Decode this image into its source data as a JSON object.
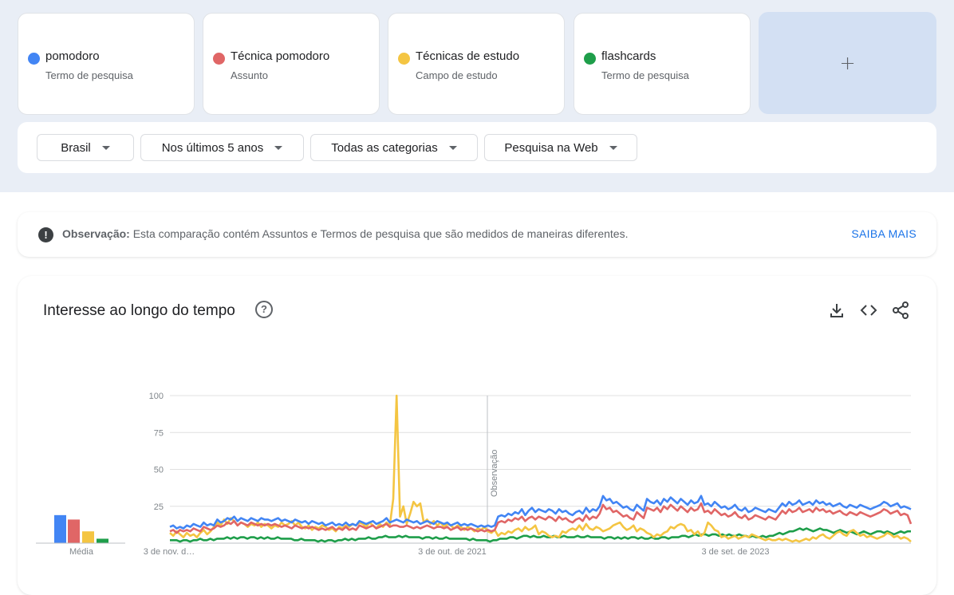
{
  "terms": [
    {
      "name": "pomodoro",
      "type": "Termo de pesquisa",
      "color": "#4285f4"
    },
    {
      "name": "Técnica pomodoro",
      "type": "Assunto",
      "color": "#e06666"
    },
    {
      "name": "Técnicas de estudo",
      "type": "Campo de estudo",
      "color": "#f4c542"
    },
    {
      "name": "flashcards",
      "type": "Termo de pesquisa",
      "color": "#1e9e4a"
    }
  ],
  "add_term_label": "+",
  "filters": {
    "region": "Brasil",
    "period": "Nos últimos 5 anos",
    "category": "Todas as categorias",
    "search_type": "Pesquisa na Web"
  },
  "note": {
    "label": "Observação:",
    "text": "Esta comparação contém Assuntos e Termos de pesquisa que são medidos de maneiras diferentes.",
    "link": "SAIBA MAIS"
  },
  "chart": {
    "title": "Interesse ao longo do tempo",
    "average_label": "Média",
    "marker_label": "Observação"
  },
  "chart_data": {
    "type": "line",
    "x_tick_labels": [
      "3 de nov. d…",
      "3 de out. de 2021",
      "3 de set. de 2023"
    ],
    "y_ticks": [
      100,
      75,
      50,
      25
    ],
    "ylim": [
      0,
      100
    ],
    "grid": true,
    "series": [
      {
        "name": "pomodoro",
        "color": "#4285f4",
        "average": 19,
        "values": [
          11,
          12,
          10,
          11,
          10,
          12,
          11,
          13,
          12,
          11,
          14,
          12,
          13,
          12,
          16,
          14,
          15,
          17,
          16,
          18,
          15,
          17,
          16,
          15,
          17,
          16,
          15,
          17,
          16,
          16,
          15,
          16,
          17,
          15,
          16,
          15,
          14,
          16,
          15,
          14,
          15,
          13,
          15,
          14,
          13,
          14,
          12,
          13,
          14,
          12,
          13,
          12,
          14,
          12,
          13,
          12,
          15,
          14,
          13,
          14,
          15,
          13,
          14,
          15,
          17,
          14,
          15,
          16,
          15,
          14,
          16,
          15,
          14,
          15,
          13,
          14,
          15,
          14,
          13,
          15,
          14,
          13,
          14,
          12,
          13,
          14,
          12,
          13,
          12,
          13,
          12,
          11,
          12,
          11,
          12,
          11,
          12,
          18,
          19,
          18,
          20,
          19,
          21,
          20,
          23,
          19,
          22,
          24,
          21,
          23,
          22,
          21,
          23,
          22,
          20,
          23,
          21,
          22,
          20,
          19,
          21,
          22,
          20,
          24,
          21,
          23,
          22,
          25,
          32,
          29,
          30,
          27,
          28,
          26,
          24,
          25,
          23,
          22,
          26,
          24,
          22,
          30,
          28,
          27,
          29,
          26,
          30,
          28,
          31,
          29,
          27,
          30,
          28,
          26,
          29,
          27,
          28,
          32,
          26,
          27,
          25,
          28,
          26,
          24,
          25,
          23,
          24,
          26,
          23,
          22,
          24,
          21,
          22,
          24,
          23,
          22,
          21,
          23,
          22,
          21,
          24,
          27,
          25,
          28,
          26,
          27,
          29,
          26,
          27,
          28,
          26,
          29,
          27,
          28,
          26,
          27,
          25,
          26,
          27,
          25,
          24,
          26,
          25,
          24,
          26,
          25,
          24,
          23,
          24,
          25,
          26,
          28,
          27,
          25,
          26,
          27,
          24,
          25,
          24,
          23
        ]
      },
      {
        "name": "Técnica pomodoro",
        "color": "#e06666",
        "average": 16,
        "values": [
          8,
          9,
          7,
          9,
          8,
          9,
          8,
          10,
          9,
          8,
          11,
          10,
          9,
          10,
          12,
          11,
          12,
          14,
          13,
          15,
          12,
          14,
          13,
          12,
          14,
          13,
          12,
          13,
          12,
          13,
          12,
          13,
          12,
          11,
          12,
          11,
          10,
          12,
          11,
          10,
          11,
          10,
          11,
          10,
          9,
          10,
          9,
          10,
          11,
          9,
          10,
          9,
          11,
          9,
          10,
          9,
          12,
          11,
          10,
          11,
          12,
          10,
          11,
          12,
          13,
          11,
          12,
          12,
          11,
          11,
          12,
          11,
          10,
          11,
          10,
          11,
          12,
          11,
          10,
          11,
          11,
          10,
          11,
          9,
          10,
          11,
          9,
          10,
          9,
          10,
          9,
          8,
          9,
          8,
          9,
          8,
          9,
          14,
          15,
          14,
          16,
          15,
          17,
          16,
          18,
          15,
          17,
          18,
          16,
          18,
          17,
          16,
          18,
          17,
          15,
          18,
          16,
          17,
          15,
          14,
          16,
          17,
          15,
          19,
          16,
          18,
          17,
          20,
          26,
          23,
          24,
          21,
          22,
          20,
          18,
          19,
          17,
          16,
          21,
          19,
          17,
          24,
          23,
          22,
          24,
          21,
          25,
          23,
          26,
          24,
          22,
          25,
          23,
          21,
          24,
          22,
          23,
          27,
          21,
          22,
          20,
          23,
          21,
          19,
          20,
          18,
          19,
          21,
          18,
          17,
          19,
          16,
          17,
          19,
          18,
          17,
          16,
          18,
          17,
          16,
          19,
          22,
          20,
          23,
          21,
          22,
          24,
          21,
          22,
          23,
          21,
          24,
          22,
          23,
          21,
          22,
          20,
          21,
          22,
          20,
          19,
          21,
          20,
          19,
          21,
          20,
          19,
          18,
          19,
          20,
          21,
          23,
          22,
          20,
          21,
          22,
          19,
          20,
          19,
          13
        ]
      },
      {
        "name": "Técnicas de estudo",
        "color": "#f4c542",
        "average": 8,
        "values": [
          7,
          5,
          8,
          6,
          4,
          7,
          5,
          6,
          4,
          7,
          9,
          6,
          8,
          11,
          14,
          12,
          16,
          13,
          17,
          15,
          12,
          14,
          13,
          11,
          13,
          12,
          14,
          11,
          13,
          12,
          10,
          12,
          11,
          14,
          12,
          13,
          15,
          12,
          14,
          11,
          10,
          12,
          9,
          11,
          10,
          12,
          11,
          9,
          10,
          8,
          11,
          10,
          12,
          11,
          13,
          12,
          14,
          13,
          11,
          14,
          12,
          10,
          13,
          11,
          14,
          12,
          30,
          100,
          18,
          25,
          13,
          20,
          28,
          25,
          27,
          14,
          16,
          13,
          15,
          12,
          14,
          11,
          13,
          12,
          10,
          12,
          11,
          9,
          11,
          10,
          8,
          10,
          9,
          11,
          8,
          7,
          9,
          5,
          7,
          6,
          8,
          7,
          9,
          10,
          8,
          11,
          9,
          10,
          12,
          6,
          8,
          7,
          5,
          4,
          5,
          4,
          8,
          7,
          9,
          10,
          9,
          12,
          9,
          13,
          10,
          9,
          11,
          10,
          8,
          9,
          10,
          12,
          13,
          14,
          11,
          9,
          10,
          12,
          8,
          10,
          9,
          7,
          6,
          4,
          6,
          5,
          7,
          8,
          11,
          10,
          12,
          13,
          12,
          8,
          9,
          6,
          8,
          5,
          7,
          14,
          12,
          9,
          8,
          4,
          5,
          3,
          4,
          5,
          3,
          4,
          5,
          4,
          6,
          5,
          4,
          3,
          2,
          3,
          2,
          2,
          3,
          2,
          3,
          2,
          1,
          2,
          1,
          2,
          3,
          2,
          4,
          3,
          5,
          6,
          4,
          3,
          5,
          7,
          8,
          6,
          5,
          8,
          9,
          7,
          5,
          6,
          4,
          5,
          4,
          3,
          4,
          5,
          7,
          6,
          4,
          5,
          3,
          4,
          3,
          1
        ]
      },
      {
        "name": "flashcards",
        "color": "#1e9e4a",
        "average": 3,
        "values": [
          2,
          2,
          2,
          1,
          2,
          2,
          1,
          2,
          2,
          3,
          2,
          2,
          3,
          2,
          3,
          3,
          3,
          4,
          3,
          4,
          3,
          4,
          4,
          3,
          4,
          4,
          3,
          4,
          3,
          4,
          3,
          3,
          4,
          3,
          3,
          3,
          3,
          2,
          2,
          3,
          2,
          2,
          2,
          2,
          1,
          2,
          1,
          2,
          2,
          1,
          2,
          2,
          3,
          2,
          3,
          2,
          3,
          3,
          3,
          4,
          3,
          3,
          4,
          4,
          5,
          4,
          4,
          4,
          5,
          4,
          5,
          4,
          4,
          4,
          4,
          3,
          4,
          4,
          3,
          4,
          3,
          3,
          4,
          3,
          3,
          3,
          3,
          3,
          3,
          2,
          3,
          2,
          2,
          2,
          2,
          1,
          2,
          2,
          3,
          3,
          3,
          4,
          4,
          3,
          4,
          5,
          5,
          4,
          5,
          4,
          4,
          5,
          4,
          4,
          5,
          4,
          4,
          5,
          4,
          4,
          4,
          5,
          4,
          4,
          5,
          4,
          4,
          4,
          4,
          3,
          4,
          4,
          3,
          4,
          3,
          4,
          3,
          4,
          4,
          3,
          4,
          3,
          3,
          4,
          3,
          3,
          4,
          4,
          3,
          4,
          4,
          4,
          5,
          5,
          4,
          5,
          6,
          5,
          6,
          6,
          5,
          6,
          6,
          5,
          6,
          5,
          6,
          5,
          5,
          6,
          5,
          5,
          4,
          5,
          4,
          4,
          5,
          4,
          5,
          5,
          6,
          7,
          6,
          7,
          8,
          8,
          9,
          10,
          9,
          10,
          9,
          8,
          9,
          10,
          9,
          9,
          8,
          7,
          8,
          9,
          8,
          7,
          8,
          7,
          6,
          7,
          8,
          7,
          6,
          7,
          8,
          8,
          7,
          8,
          7,
          6,
          7,
          8,
          7,
          8,
          8
        ]
      }
    ]
  }
}
